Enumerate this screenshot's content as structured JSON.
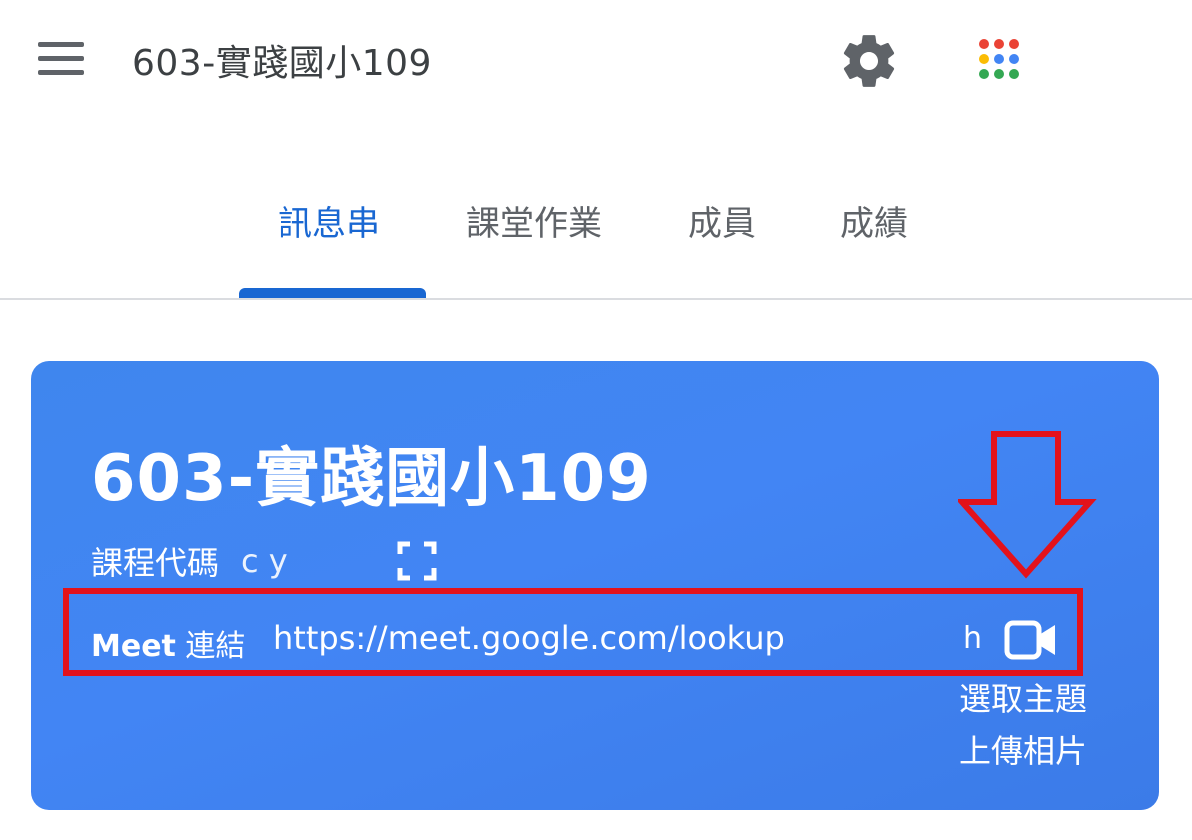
{
  "appbar": {
    "title": "603-實踐國小109",
    "menu_icon": "hamburger-menu-icon",
    "settings_icon": "gear-icon",
    "apps_icon": "google-apps-grid-icon",
    "apps_dot_colors": [
      "#ea4335",
      "#ea4335",
      "#ea4335",
      "#fbbc04",
      "#4285f4",
      "#4285f4",
      "#34a853",
      "#34a853",
      "#34a853"
    ]
  },
  "tabs": [
    {
      "label": "訊息串",
      "active": true
    },
    {
      "label": "課堂作業",
      "active": false
    },
    {
      "label": "成員",
      "active": false
    },
    {
      "label": "成績",
      "active": false
    }
  ],
  "banner": {
    "title": "603-實踐國小109",
    "class_code_label": "課程代碼",
    "class_code_value": "c      y",
    "fullscreen_icon": "fullscreen-icon",
    "meet_label_bold": "Meet",
    "meet_label_rest": " 連結",
    "meet_link": "https://meet.google.com/lookup",
    "meet_link_tail": "h",
    "video_icon": "video-camera-icon",
    "select_theme": "選取主題",
    "upload_photo": "上傳相片",
    "background_color": "#4285f4"
  },
  "annotations": {
    "color": "#e3121b",
    "arrow_icon": "down-arrow-outline-icon"
  }
}
